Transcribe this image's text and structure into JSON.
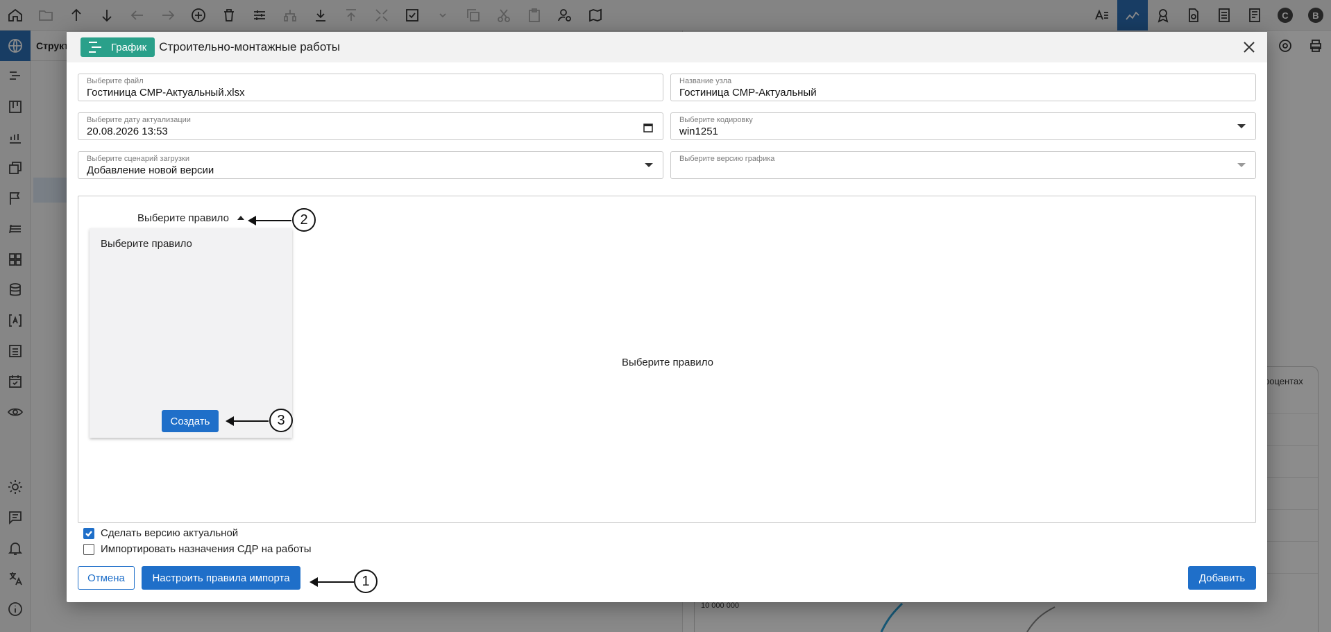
{
  "background": {
    "tree_header": "Структ",
    "chart_legend": "процентах",
    "chart_tick": "10 000 000"
  },
  "dialog": {
    "badge": "График",
    "title": "Строительно-монтажные работы",
    "fields": {
      "file": {
        "label": "Выберите файл",
        "value": "Гостиница СМР-Актуальный.xlsx"
      },
      "node_name": {
        "label": "Название узла",
        "value": "Гостиница СМР-Актуальный"
      },
      "date": {
        "label": "Выберите дату актуализации",
        "value": "20.08.2026 13:53"
      },
      "encoding": {
        "label": "Выберите кодировку",
        "value": "win1251"
      },
      "scenario": {
        "label": "Выберите сценарий загрузки",
        "value": "Добавление новой версии"
      },
      "schedule_version": {
        "label": "Выберите версию графика",
        "value": ""
      }
    },
    "rules": {
      "dropdown_label": "Выберите правило",
      "menu_item": "Выберите правило",
      "create_button": "Создать",
      "placeholder": "Выберите правило"
    },
    "checkboxes": {
      "make_current": {
        "label": "Сделать версию актуальной",
        "checked": true
      },
      "import_wbs": {
        "label": "Импортировать назначения СДР на работы",
        "checked": false
      }
    },
    "buttons": {
      "cancel": "Отмена",
      "configure_rules": "Настроить правила импорта",
      "add": "Добавить"
    }
  },
  "annotations": [
    "1",
    "2",
    "3"
  ],
  "colors": {
    "accent": "#1f6fc9",
    "badge": "#2aa08a",
    "active_tab": "#2c6fb6"
  }
}
